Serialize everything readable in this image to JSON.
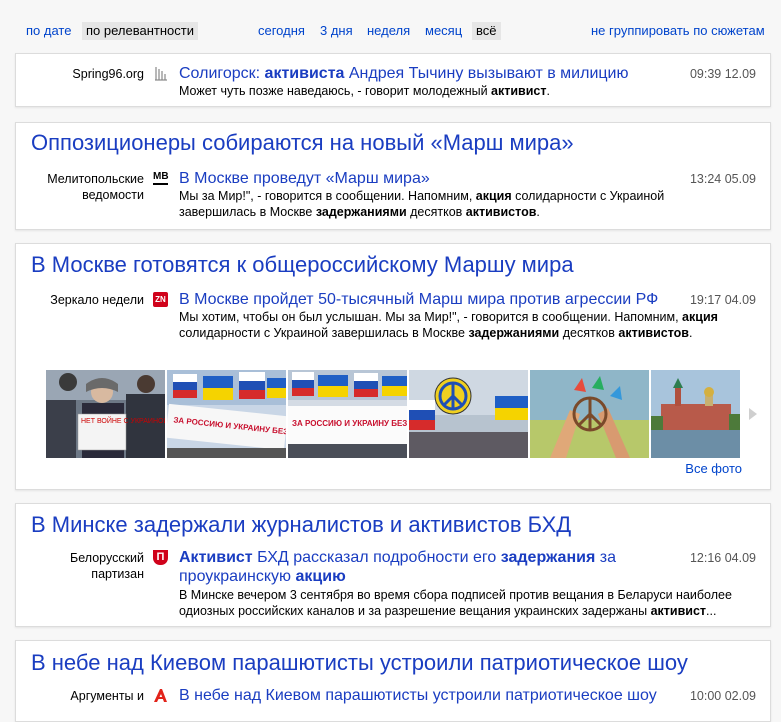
{
  "topbar": {
    "by_date": "по дате",
    "by_relevance": "по релевантности",
    "today": "сегодня",
    "three_days": "3 дня",
    "week": "неделя",
    "month": "месяц",
    "all": "всё",
    "no_grouping": "не группировать по сюжетам"
  },
  "cards": [
    {
      "items": [
        {
          "source": "Spring96.org",
          "icon": "spring96-icon",
          "title_parts": [
            "Солигорск: ",
            "активиста",
            " Андрея Тычину вызывают в милицию"
          ],
          "snippet_parts": [
            "Может чуть позже наведаюсь, - говорит молодежный ",
            "активист",
            "."
          ],
          "time": "09:39 12.09"
        }
      ]
    },
    {
      "headline": "Оппозиционеры собираются на новый «Марш мира»",
      "items": [
        {
          "source": "Мелитопольские ведомости",
          "icon": "mv-logo-icon",
          "icon_text": "MB",
          "title": "В Москве проведут «Марш мира»",
          "snippet_parts": [
            "Мы за Мир!\", - говорится в сообщении. Напомним, ",
            "акция",
            " солидарности с Украиной завершилась в Москве ",
            "задержаниями",
            " десятков ",
            "активистов",
            "."
          ],
          "time": "13:24 05.09"
        }
      ]
    },
    {
      "headline": "В Москве готовятся к общероссийскому Маршу мира",
      "items": [
        {
          "source": "Зеркало недели",
          "icon": "zn-logo-icon",
          "icon_text": "ZN",
          "title": "В Москве пройдет 50-тысячный Марш мира против агрессии РФ",
          "snippet_parts": [
            "Мы хотим, чтобы он был услышан. Мы за Мир!\", - говорится в сообщении. Напомним, ",
            "акция",
            " солидарности с Украиной завершилась в Москве ",
            "задержаниями",
            " десятков ",
            "активистов",
            "."
          ],
          "time": "19:17 04.09"
        }
      ],
      "photos_link": "Все фото",
      "photo_banners": [
        "ЗА РОССИЮ И УКРАИНУ БЕЗ ПУТИНА!",
        "ЗА РОССИЮ И УКРАИНУ БЕЗ ПУТИНА!"
      ],
      "photo_sign": "НЕТ ВОЙНЕ С УКРАИНОЙ"
    },
    {
      "headline": "В Минске задержали журналистов и активистов БХД",
      "items": [
        {
          "source": "Белорусский партизан",
          "icon": "partizan-logo-icon",
          "icon_text": "П",
          "title_parts": [
            "Активист",
            " БХД рассказал подробности его ",
            "задержания",
            " за проукраинскую ",
            "акцию"
          ],
          "snippet_parts": [
            "В Минске вечером 3 сентября во время сбора подписей против вещания в Беларуси наиболее одиозных российских каналов и за разрешение вещания украинских задержаны ",
            "активист",
            "..."
          ],
          "time": "12:16 04.09"
        }
      ]
    },
    {
      "headline": "В небе над Киевом парашютисты устроили патриотическое шоу",
      "items": [
        {
          "source": "Аргументы и",
          "icon": "aif-logo-icon",
          "title": "В небе над Киевом парашютисты устроили патриотическое шоу",
          "time": "10:00 02.09"
        }
      ]
    }
  ]
}
